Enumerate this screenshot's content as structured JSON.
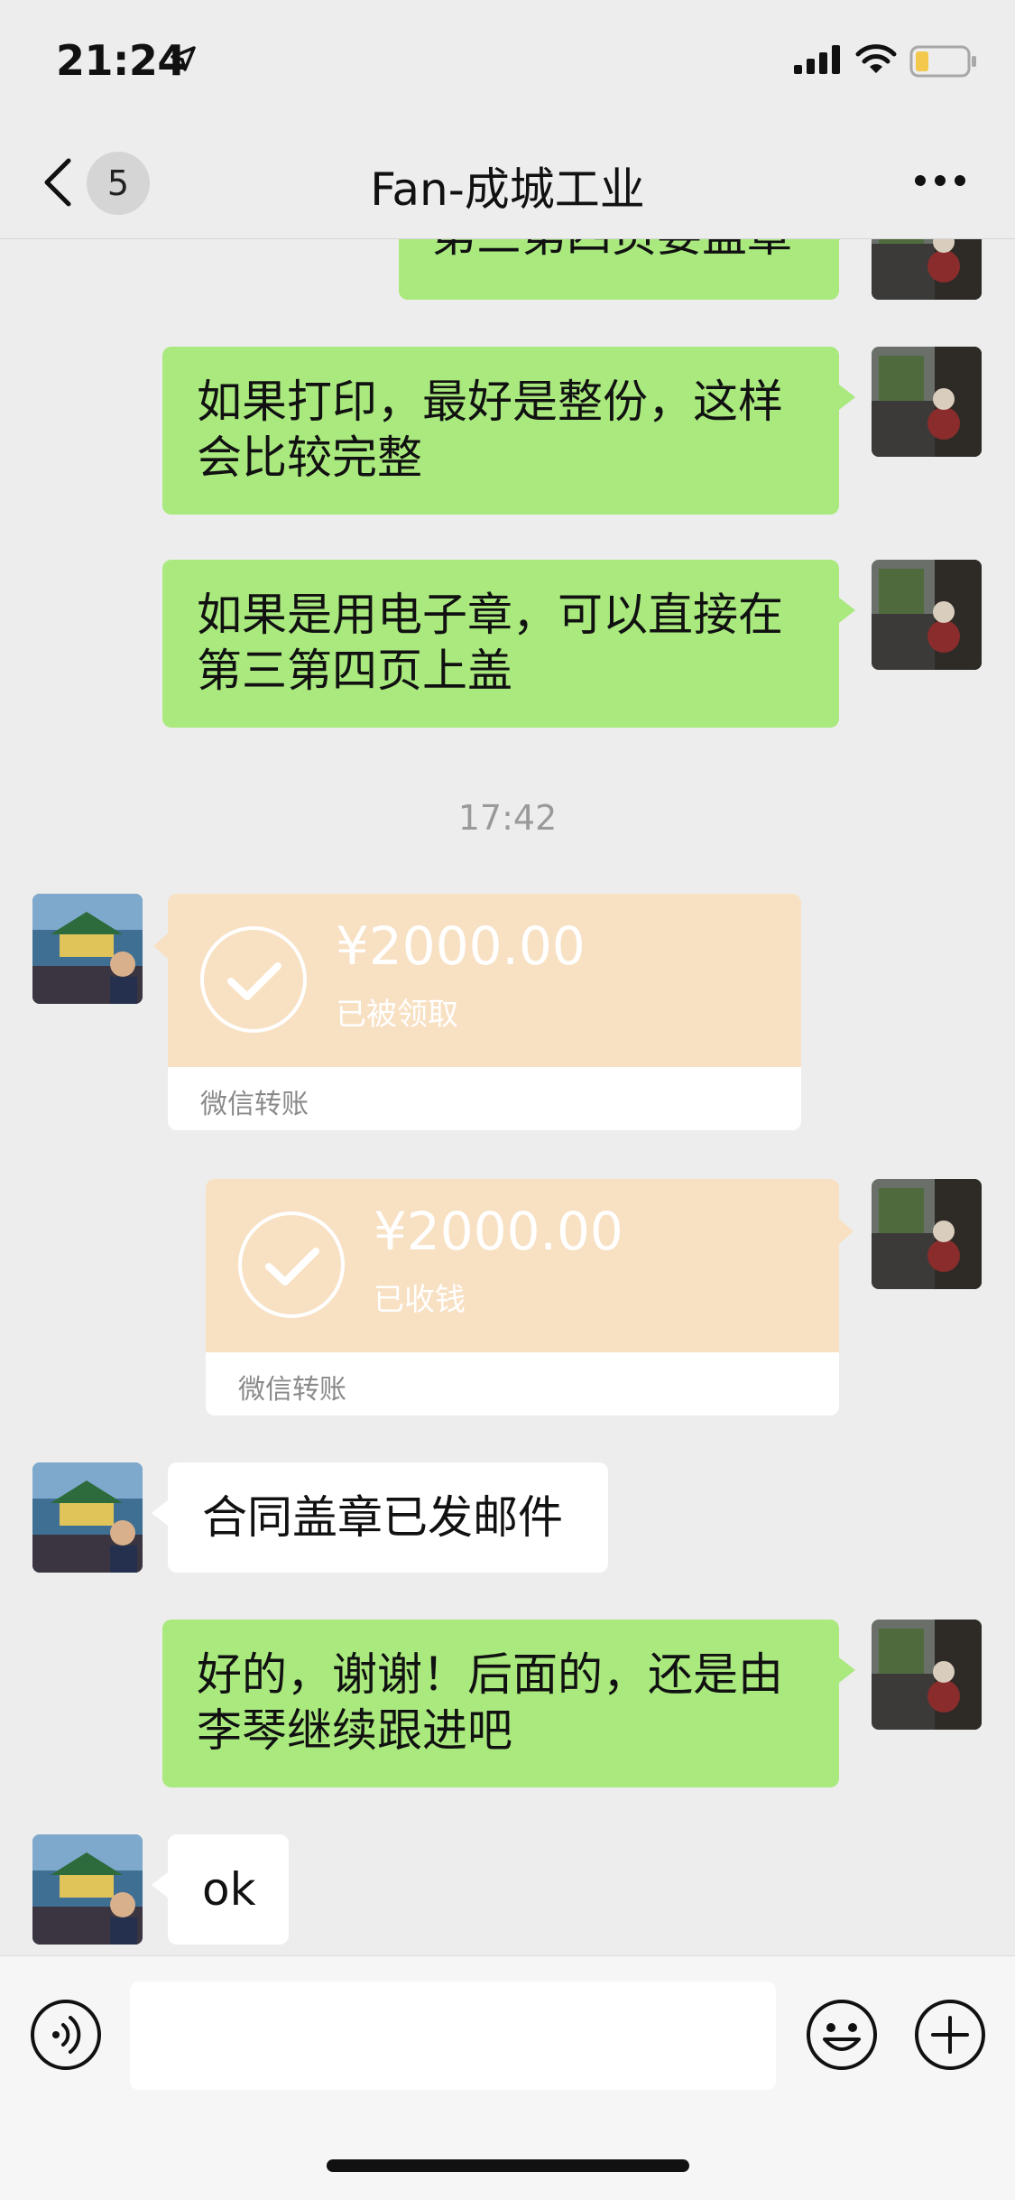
{
  "status_bar": {
    "time": "21:24"
  },
  "nav": {
    "back_badge": "5",
    "title": "Fan-成城工业"
  },
  "messages": {
    "m0": {
      "text": "第三第四页要盖章"
    },
    "m1": {
      "line1": "如果打印，最好是整份，这样",
      "line2": "会比较完整"
    },
    "m2": {
      "line1": "如果是用电子章，可以直接在",
      "line2": "第三第四页上盖"
    },
    "timestamp": "17:42",
    "t1": {
      "amount": "¥2000.00",
      "status": "已被领取",
      "footer": "微信转账"
    },
    "t2": {
      "amount": "¥2000.00",
      "status": "已收钱",
      "footer": "微信转账"
    },
    "m3": {
      "text": "合同盖章已发邮件"
    },
    "m4": {
      "line1": "好的，谢谢！后面的，还是由",
      "line2": "李琴继续跟进吧"
    },
    "m5": {
      "text": "ok"
    }
  },
  "input": {
    "value": ""
  },
  "colors": {
    "sent_bubble": "#a9e97e",
    "received_bubble": "#ffffff",
    "transfer": "#f8e0c3",
    "background": "#ededed"
  },
  "icons": [
    "location-arrow-icon",
    "signal-icon",
    "wifi-icon",
    "battery-icon",
    "back-chevron-icon",
    "more-icon",
    "voice-icon",
    "emoji-icon",
    "plus-icon",
    "check-icon"
  ]
}
